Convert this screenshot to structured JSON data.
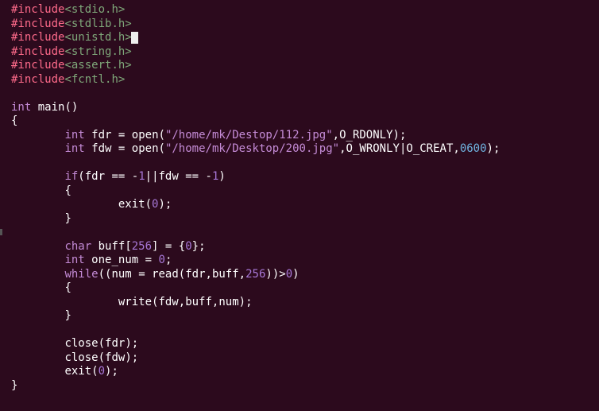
{
  "code": {
    "includes": [
      {
        "kw": "#include",
        "hdr": "<stdio.h>"
      },
      {
        "kw": "#include",
        "hdr": "<stdlib.h>"
      },
      {
        "kw": "#include",
        "hdr": "<unistd.h>",
        "cursor_after": true
      },
      {
        "kw": "#include",
        "hdr": "<string.h>"
      },
      {
        "kw": "#include",
        "hdr": "<assert.h>"
      },
      {
        "kw": "#include",
        "hdr": "<fcntl.h>"
      }
    ],
    "ret_type": "int",
    "fn_name": "main",
    "fdr_decl": {
      "type": "int",
      "name": "fdr",
      "fn": "open",
      "path": "\"/home/mk/Destop/112.jpg\"",
      "flags": "O_RDONLY"
    },
    "fdw_decl": {
      "type": "int",
      "name": "fdw",
      "fn": "open",
      "path": "\"/home/mk/Desktop/200.jpg\"",
      "flags": "O_WRONLY|O_CREAT",
      "mode": "0600"
    },
    "if_cond": {
      "kw": "if",
      "lhs": "fdr",
      "op1": "==",
      "neg1": "-1",
      "join": "||",
      "rhs": "fdw",
      "op2": "==",
      "neg2": "-1"
    },
    "exit0": {
      "fn": "exit",
      "arg": "0"
    },
    "buff_decl": {
      "type": "char",
      "name": "buff",
      "size": "256",
      "init": "0"
    },
    "one_num": {
      "type": "int",
      "name": "one_num",
      "init": "0"
    },
    "while": {
      "kw": "while",
      "assign_lhs": "num",
      "fn": "read",
      "a1": "fdr",
      "a2": "buff",
      "a3": "256",
      "cmp": ">",
      "rhs": "0"
    },
    "write": {
      "fn": "write",
      "a1": "fdw",
      "a2": "buff",
      "a3": "num"
    },
    "close1": {
      "fn": "close",
      "arg": "fdr"
    },
    "close2": {
      "fn": "close",
      "arg": "fdw"
    },
    "exit_end": {
      "fn": "exit",
      "arg": "0"
    }
  }
}
